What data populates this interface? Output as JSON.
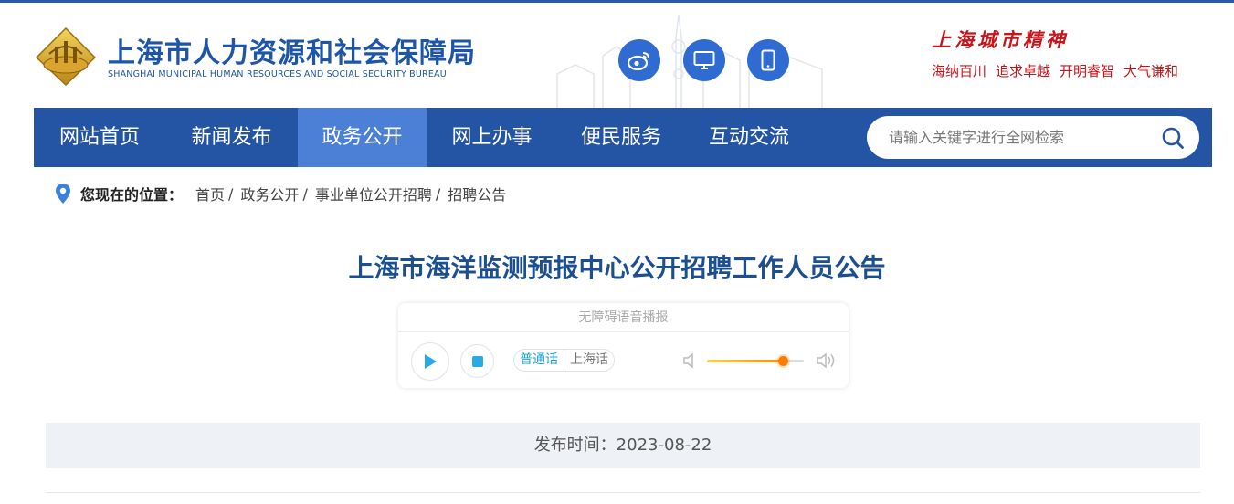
{
  "header": {
    "brand_cn": "上海市人力资源和社会保障局",
    "brand_en": "SHANGHAI MUNICIPAL HUMAN RESOURCES AND SOCIAL SECURITY BUREAU",
    "social_icons": [
      "weibo-icon",
      "desktop-icon",
      "mobile-icon"
    ],
    "spirit_title": "上海城市精神",
    "spirit_words": [
      "海纳百川",
      "追求卓越",
      "开明睿智",
      "大气谦和"
    ]
  },
  "nav": {
    "items": [
      "网站首页",
      "新闻发布",
      "政务公开",
      "网上办事",
      "便民服务",
      "互动交流"
    ],
    "active": "政务公开",
    "search_placeholder": "请输入关键字进行全网检索"
  },
  "breadcrumb": {
    "label": "您现在的位置：",
    "items": [
      "首页",
      "政务公开",
      "事业单位公开招聘",
      "招聘公告"
    ]
  },
  "article": {
    "title": "上海市海洋监测预报中心公开招聘工作人员公告",
    "publish_time": "发布时间：2023-08-22"
  },
  "player": {
    "header": "无障碍语音播报",
    "lang_options": [
      "普通话",
      "上海话"
    ],
    "selected_lang": "普通话",
    "volume": 0.78
  },
  "colors": {
    "nav_bg": "#2455a4",
    "nav_active": "#4b80d6",
    "brand_blue": "#1d56a8",
    "title_blue": "#1c4f91",
    "spirit_red": "#c8141b",
    "accent_cyan": "#1aa3d9"
  }
}
